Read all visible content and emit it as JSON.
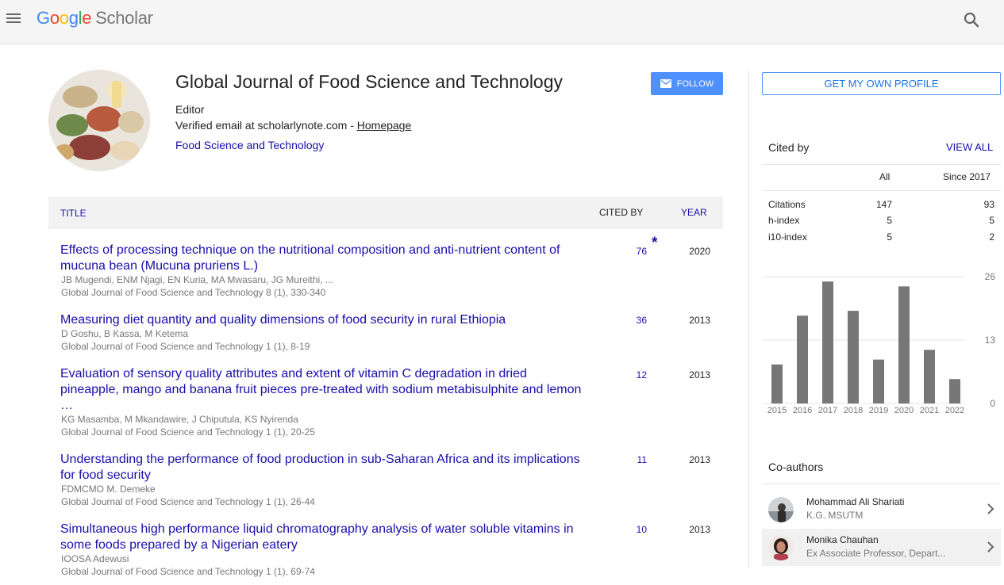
{
  "header": {
    "logo_google": [
      "G",
      "o",
      "o",
      "g",
      "l",
      "e"
    ],
    "logo_scholar": "Scholar"
  },
  "profile": {
    "name": "Global Journal of Food Science and Technology",
    "affiliation": "Editor",
    "email_text": "Verified email at scholarlynote.com - ",
    "homepage_label": "Homepage",
    "interest": "Food Science and Technology",
    "follow_label": "FOLLOW"
  },
  "table": {
    "col_title": "TITLE",
    "col_cited": "CITED BY",
    "col_year": "YEAR",
    "rows": [
      {
        "title": "Effects of processing technique on the nutritional composition and anti-nutrient content of mucuna bean (Mucuna pruriens L.)",
        "authors": "JB Mugendi, ENM Njagi, EN Kuria, MA Mwasaru, JG Mureithi, ...",
        "venue": "Global Journal of Food Science and Technology 8 (1), 330-340",
        "cited": "76",
        "star": "*",
        "year": "2020"
      },
      {
        "title": "Measuring diet quantity and quality dimensions of food security in rural Ethiopia",
        "authors": "D Goshu, B Kassa, M Ketema",
        "venue": "Global Journal of Food Science and Technology 1 (1), 8-19",
        "cited": "36",
        "year": "2013"
      },
      {
        "title": "Evaluation of sensory quality attributes and extent of vitamin C degradation in dried pineapple, mango and banana fruit pieces pre-treated with sodium metabisulphite and lemon …",
        "authors": "KG Masamba, M Mkandawire, J Chiputula, KS Nyirenda",
        "venue": "Global Journal of Food Science and Technology 1 (1), 20-25",
        "cited": "12",
        "year": "2013"
      },
      {
        "title": "Understanding the performance of food production in sub-Saharan Africa and its implications for food security",
        "authors": "FDMCMO M. Demeke",
        "venue": "Global Journal of Food Science and Technology 1 (1), 26-44",
        "cited": "11",
        "year": "2013"
      },
      {
        "title": "Simultaneous high performance liquid chromatography analysis of water soluble vitamins in some foods prepared by a Nigerian eatery",
        "authors": "IOOSA Adewusi",
        "venue": "Global Journal of Food Science and Technology 1 (1), 69-74",
        "cited": "10",
        "year": "2013"
      }
    ]
  },
  "sidebar": {
    "own_profile_label": "GET MY OWN PROFILE",
    "cited_by_heading": "Cited by",
    "view_all_label": "VIEW ALL",
    "stats_headers": [
      "All",
      "Since 2017"
    ],
    "stats": [
      {
        "label": "Citations",
        "all": "147",
        "since": "93"
      },
      {
        "label": "h-index",
        "all": "5",
        "since": "5"
      },
      {
        "label": "i10-index",
        "all": "5",
        "since": "2"
      }
    ],
    "coauthors_heading": "Co-authors",
    "coauthors": [
      {
        "name": "Mohammad Ali Shariati",
        "affiliation": "K.G. MSUTM"
      },
      {
        "name": "Monika Chauhan",
        "affiliation": "Ex Associate Professor, Depart..."
      }
    ]
  },
  "chart_data": {
    "type": "bar",
    "categories": [
      "2015",
      "2016",
      "2017",
      "2018",
      "2019",
      "2020",
      "2021",
      "2022"
    ],
    "values": [
      8,
      18,
      25,
      19,
      9,
      24,
      11,
      5
    ],
    "ytick_labels": [
      "0",
      "13",
      "26"
    ],
    "ylim": [
      0,
      26
    ],
    "grid": true,
    "bar_color": "#777777"
  },
  "colors": {
    "link": "#1a0dab",
    "accent": "#4d90fe",
    "muted": "#777777"
  }
}
